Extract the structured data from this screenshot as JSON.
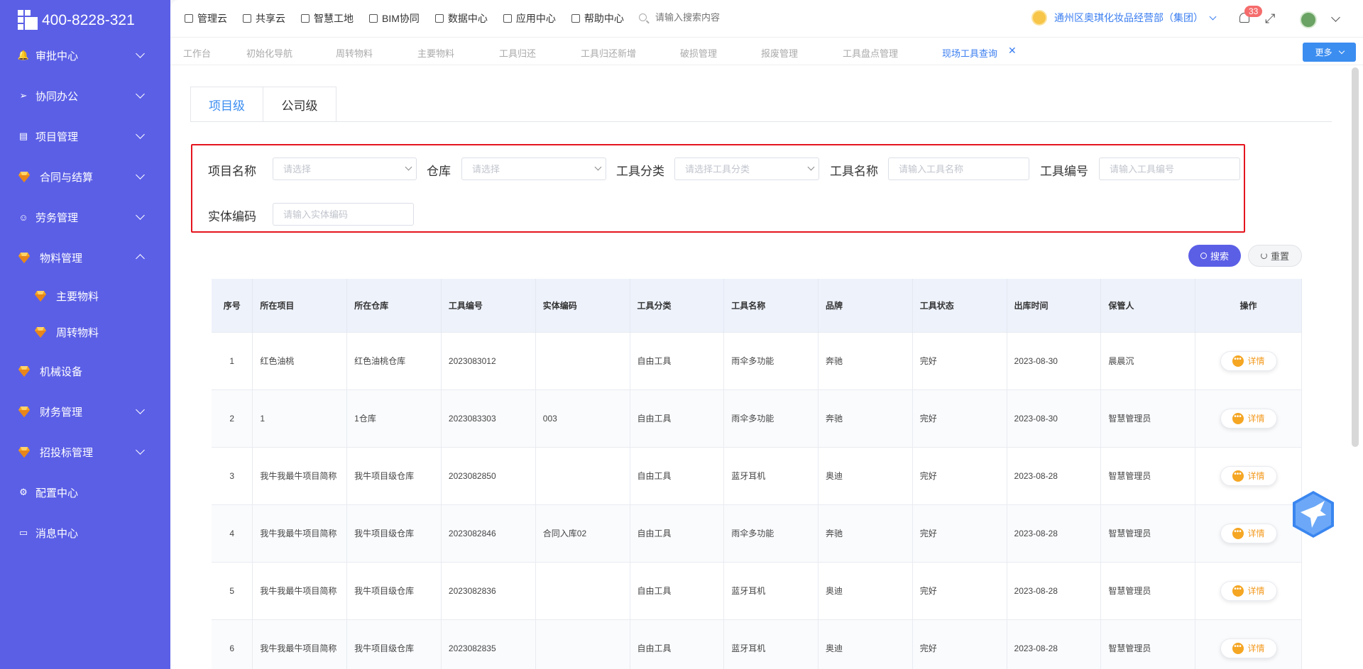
{
  "brand": {
    "phone": "400-8228-321"
  },
  "sidebar": {
    "items": [
      {
        "label": "审批中心",
        "icon": "bell-icon",
        "expandable": true
      },
      {
        "label": "协同办公",
        "icon": "send-icon",
        "expandable": true
      },
      {
        "label": "项目管理",
        "icon": "document-icon",
        "expandable": true
      },
      {
        "label": "合同与结算",
        "icon": "gem-icon",
        "expandable": true
      },
      {
        "label": "劳务管理",
        "icon": "user-icon",
        "expandable": true
      },
      {
        "label": "物料管理",
        "icon": "gem-icon",
        "expandable": true,
        "expanded": true
      },
      {
        "label": "主要物料",
        "icon": "gem-icon",
        "sub": true
      },
      {
        "label": "周转物料",
        "icon": "gem-icon",
        "sub": true
      },
      {
        "label": "机械设备",
        "icon": "gem-icon"
      },
      {
        "label": "财务管理",
        "icon": "gem-icon",
        "expandable": true
      },
      {
        "label": "招投标管理",
        "icon": "gem-icon",
        "expandable": true
      },
      {
        "label": "配置中心",
        "icon": "gear-icon"
      },
      {
        "label": "消息中心",
        "icon": "message-icon"
      }
    ]
  },
  "topnav": {
    "items": [
      "管理云",
      "共享云",
      "智慧工地",
      "BIM协同",
      "数据中心",
      "应用中心",
      "帮助中心"
    ],
    "search_placeholder": "请输入搜索内容",
    "org": "通州区奥琪化妆品经营部（集团）",
    "notification_count": "33"
  },
  "tabs": {
    "items": [
      "工作台",
      "初始化导航",
      "周转物料",
      "主要物料",
      "工具归还",
      "工具归还新增",
      "破损管理",
      "报废管理",
      "工具盘点管理",
      "现场工具查询"
    ],
    "active": "现场工具查询",
    "more": "更多"
  },
  "level_tabs": {
    "project": "项目级",
    "company": "公司级"
  },
  "filters": {
    "project_name": {
      "label": "项目名称",
      "placeholder": "请选择"
    },
    "warehouse": {
      "label": "仓库",
      "placeholder": "请选择"
    },
    "tool_category": {
      "label": "工具分类",
      "placeholder": "请选择工具分类"
    },
    "tool_name": {
      "label": "工具名称",
      "placeholder": "请输入工具名称"
    },
    "tool_code": {
      "label": "工具编号",
      "placeholder": "请输入工具编号"
    },
    "entity_code": {
      "label": "实体编码",
      "placeholder": "请输入实体编码"
    }
  },
  "actions": {
    "search": "搜索",
    "reset": "重置"
  },
  "table": {
    "columns": [
      "序号",
      "所在项目",
      "所在仓库",
      "工具编号",
      "实体编码",
      "工具分类",
      "工具名称",
      "品牌",
      "工具状态",
      "出库时间",
      "保管人",
      "操作"
    ],
    "detail_label": "详情",
    "rows": [
      [
        "1",
        "红色油桃",
        "红色油桃仓库",
        "2023083012",
        "",
        "自由工具",
        "雨伞多功能",
        "奔驰",
        "完好",
        "2023-08-30",
        "晨晨沉"
      ],
      [
        "2",
        "1",
        "1仓库",
        "2023083303",
        "003",
        "自由工具",
        "雨伞多功能",
        "奔驰",
        "完好",
        "2023-08-30",
        "智慧管理员"
      ],
      [
        "3",
        "我牛我最牛项目简称",
        "我牛项目级仓库",
        "2023082850",
        "",
        "自由工具",
        "蓝牙耳机",
        "奥迪",
        "完好",
        "2023-08-28",
        "智慧管理员"
      ],
      [
        "4",
        "我牛我最牛项目简称",
        "我牛项目级仓库",
        "2023082846",
        "合同入库02",
        "自由工具",
        "雨伞多功能",
        "奔驰",
        "完好",
        "2023-08-28",
        "智慧管理员"
      ],
      [
        "5",
        "我牛我最牛项目简称",
        "我牛项目级仓库",
        "2023082836",
        "",
        "自由工具",
        "蓝牙耳机",
        "奥迪",
        "完好",
        "2023-08-28",
        "智慧管理员"
      ],
      [
        "6",
        "我牛我最牛项目简称",
        "我牛项目级仓库",
        "2023082835",
        "",
        "自由工具",
        "蓝牙耳机",
        "奥迪",
        "完好",
        "2023-08-28",
        "智慧管理员"
      ]
    ]
  },
  "colors": {
    "sidebar": "#5b5fe6",
    "accent": "#3b8df0",
    "highlight_border": "#e5151f",
    "detail": "#f39a1f"
  }
}
